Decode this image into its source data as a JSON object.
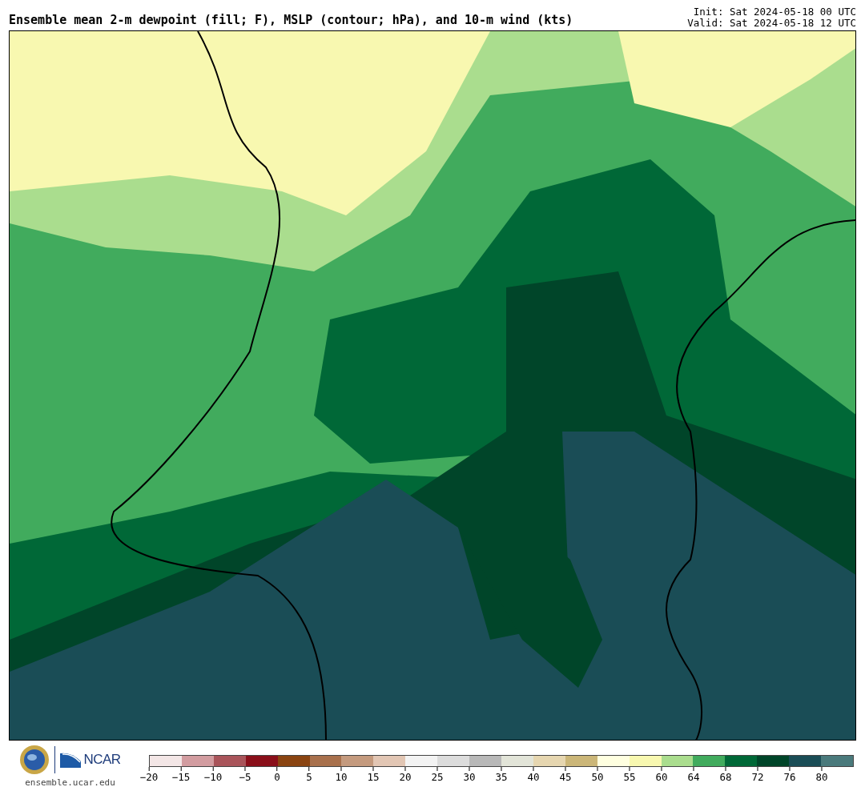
{
  "title": "Ensemble mean 2-m dewpoint (fill; F), MSLP (contour; hPa), and 10-m wind (kts)",
  "init": "Init: Sat 2024-05-18 00 UTC",
  "valid": "Valid: Sat 2024-05-18 12 UTC",
  "footer": {
    "logo_text": "NCAR",
    "site": "ensemble.ucar.edu"
  },
  "colorbar": {
    "swatches": [
      {
        "color": "#f3e6e6"
      },
      {
        "color": "#d29ca0"
      },
      {
        "color": "#a9545a"
      },
      {
        "color": "#8a0f1a"
      },
      {
        "color": "#8a4411"
      },
      {
        "color": "#a8704c"
      },
      {
        "color": "#c49a7e"
      },
      {
        "color": "#e2c6b4"
      },
      {
        "color": "#f3f3f3"
      },
      {
        "color": "#dcdcdc"
      },
      {
        "color": "#b8b8b8"
      },
      {
        "color": "#e2e4d8"
      },
      {
        "color": "#e6d6b0"
      },
      {
        "color": "#cbb678"
      },
      {
        "color": "#ffffe0"
      },
      {
        "color": "#f8f8b0"
      },
      {
        "color": "#aadd8e"
      },
      {
        "color": "#41ab5d"
      },
      {
        "color": "#006837"
      },
      {
        "color": "#004529"
      },
      {
        "color": "#1a4d56"
      },
      {
        "color": "#4a7a7c"
      }
    ],
    "ticks": [
      "−20",
      "−15",
      "−10",
      "−5",
      "0",
      "5",
      "10",
      "15",
      "20",
      "25",
      "30",
      "35",
      "40",
      "45",
      "50",
      "55",
      "60",
      "64",
      "68",
      "72",
      "76",
      "80"
    ]
  }
}
